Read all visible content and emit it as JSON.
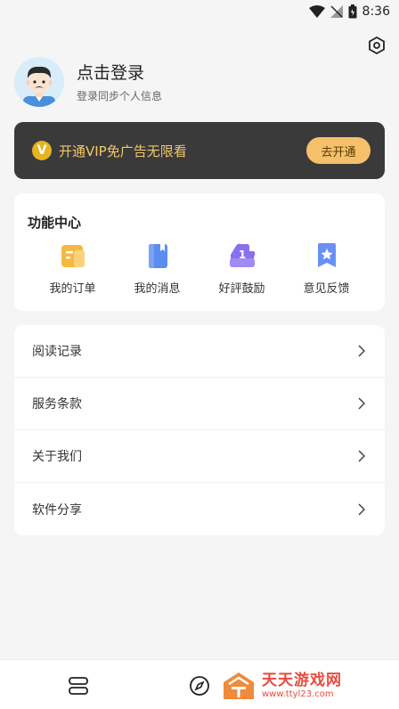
{
  "status_bar": {
    "time": "8:36",
    "icons": [
      "wifi-icon",
      "signal-off-icon",
      "battery-icon"
    ]
  },
  "header": {
    "settings_icon": "settings-icon"
  },
  "profile": {
    "title": "点击登录",
    "subtitle": "登录同步个人信息",
    "avatar_icon": "avatar-cartoon-man"
  },
  "vip": {
    "badge": "V",
    "text": "开通VIP免广告无限看",
    "button": "去开通",
    "colors": {
      "bg": "#3a3a3a",
      "text": "#f2c76b",
      "button": "#f4c06a"
    }
  },
  "functions": {
    "title": "功能中心",
    "items": [
      {
        "label": "我的订单",
        "icon": "order-icon",
        "color": "#f5b942"
      },
      {
        "label": "我的消息",
        "icon": "message-icon",
        "color": "#5b8def"
      },
      {
        "label": "好評鼓励",
        "icon": "rating-icon",
        "color": "#8a6ff0"
      },
      {
        "label": "意见反馈",
        "icon": "feedback-icon",
        "color": "#6a8ff5"
      }
    ]
  },
  "menu": {
    "items": [
      {
        "label": "阅读记录"
      },
      {
        "label": "服务条款"
      },
      {
        "label": "关于我们"
      },
      {
        "label": "软件分享"
      }
    ]
  },
  "bottom_nav": {
    "items": [
      "bookshelf-icon",
      "compass-icon",
      "profile-icon"
    ]
  },
  "watermark": {
    "title": "天天游戏网",
    "url": "www.ttyl23.com"
  }
}
